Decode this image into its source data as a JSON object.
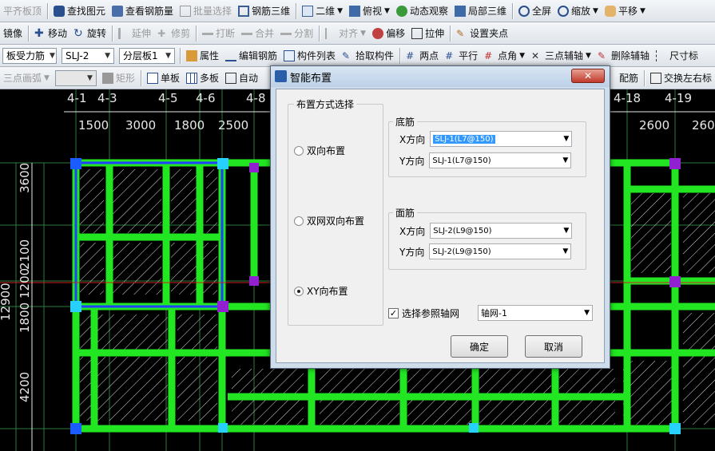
{
  "toolbar1": {
    "items": [
      "平齐板顶",
      "查找图元",
      "查看钢筋量",
      "批量选择",
      "钢筋三维",
      "二维",
      "俯视",
      "动态观察",
      "局部三维",
      "全屏",
      "缩放",
      "平移"
    ]
  },
  "toolbar2": {
    "items": [
      "镜像",
      "移动",
      "旋转",
      "延伸",
      "修剪",
      "打断",
      "合并",
      "分割",
      "对齐",
      "偏移",
      "拉伸",
      "设置夹点"
    ]
  },
  "toolbar3": {
    "dd1": "板受力筋",
    "dd2": "SLJ-2",
    "dd3": "分层板1",
    "items": [
      "属性",
      "编辑钢筋",
      "构件列表",
      "拾取构件",
      "两点",
      "平行",
      "点角",
      "三点辅轴",
      "删除辅轴",
      "尺寸标"
    ]
  },
  "toolbar4": {
    "items": [
      "三点画弧",
      "矩形",
      "单板",
      "多板",
      "自动"
    ],
    "right_items": [
      "配筋",
      "交换左右标"
    ]
  },
  "axis_top": [
    "4-1",
    "4-3",
    "4-5",
    "4-6",
    "4-8",
    "4-18",
    "4-19"
  ],
  "dims_top": [
    "1500",
    "3000",
    "1800",
    "2500",
    "2600",
    "260"
  ],
  "dims_left": [
    "3600",
    "2100",
    "1200",
    "1800",
    "4200"
  ],
  "dim_total_left": "12900",
  "dialog": {
    "title": "智能布置",
    "layout_group": "布置方式选择",
    "options": [
      {
        "label": "双向布置",
        "checked": false
      },
      {
        "label": "双网双向布置",
        "checked": false
      },
      {
        "label": "XY向布置",
        "checked": true
      }
    ],
    "bottom_group": "底筋",
    "top_group": "面筋",
    "x_label": "X方向",
    "y_label": "Y方向",
    "bottom_x": "SLJ-1(L7@150)",
    "bottom_y": "SLJ-1(L7@150)",
    "top_x": "SLJ-2(L9@150)",
    "top_y": "SLJ-2(L9@150)",
    "ref_axis_label": "选择参照轴网",
    "ref_axis_value": "轴网-1",
    "ok": "确定",
    "cancel": "取消"
  }
}
